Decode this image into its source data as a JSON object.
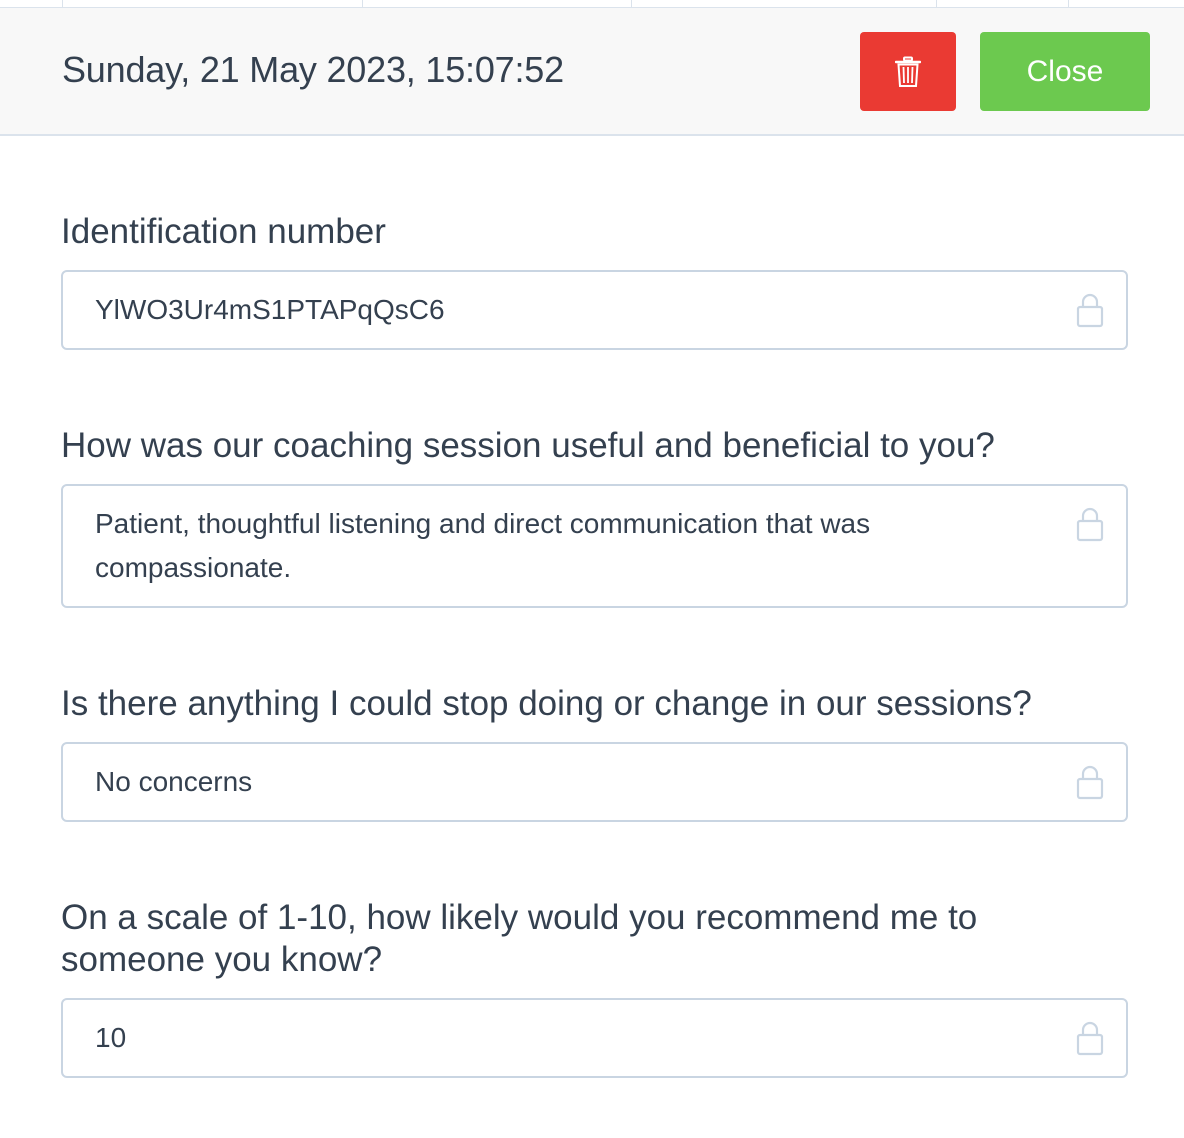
{
  "header": {
    "datetime": "Sunday, 21 May 2023, 15:07:52",
    "close_label": "Close"
  },
  "icons": {
    "delete": "trash-icon",
    "locked": "lock-icon"
  },
  "colors": {
    "delete_button": "#ea3a33",
    "close_button": "#6cc94f",
    "field_border": "#c9d5e2",
    "text": "#34404f"
  },
  "fields": [
    {
      "label": "Identification number",
      "value": "YlWO3Ur4mS1PTAPqQsC6"
    },
    {
      "label": "How was our coaching session useful and beneficial to you?",
      "value": "Patient, thoughtful listening and direct communication that was compassionate."
    },
    {
      "label": "Is there anything I could stop doing or change in our sessions?",
      "value": "No concerns"
    },
    {
      "label": "On a scale of 1-10, how likely would you recommend me to someone you know?",
      "value": "10"
    }
  ]
}
